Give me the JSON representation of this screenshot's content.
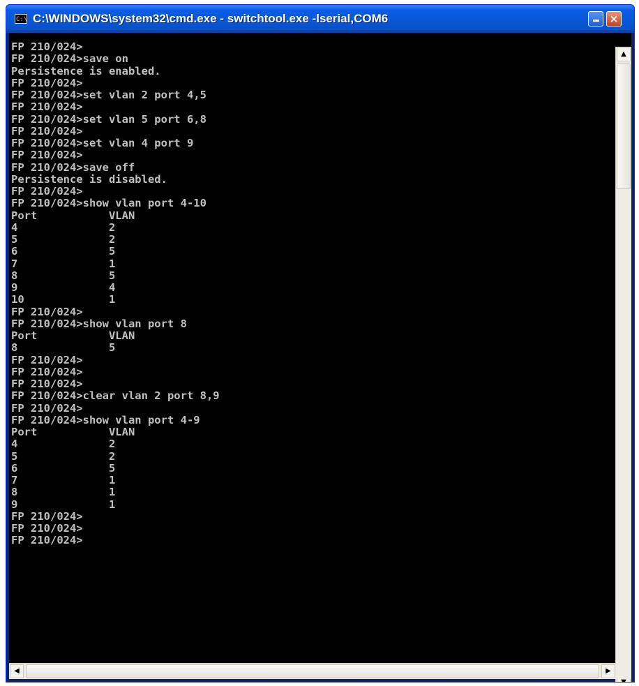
{
  "window": {
    "title": "C:\\WINDOWS\\system32\\cmd.exe - switchtool.exe -lserial,COM6",
    "icon": "cmd-icon",
    "icon_glyph": "C:\\",
    "minimize_glyph": "_",
    "close_glyph": "×"
  },
  "console": {
    "lines": [
      "FP 210/024>",
      "FP 210/024>save on",
      "Persistence is enabled.",
      "FP 210/024>",
      "FP 210/024>set vlan 2 port 4,5",
      "FP 210/024>",
      "FP 210/024>set vlan 5 port 6,8",
      "FP 210/024>",
      "FP 210/024>set vlan 4 port 9",
      "FP 210/024>",
      "FP 210/024>save off",
      "Persistence is disabled.",
      "FP 210/024>",
      "FP 210/024>show vlan port 4-10",
      "Port           VLAN",
      "4              2",
      "5              2",
      "6              5",
      "7              1",
      "8              5",
      "9              4",
      "10             1",
      "FP 210/024>",
      "FP 210/024>show vlan port 8",
      "Port           VLAN",
      "8              5",
      "FP 210/024>",
      "FP 210/024>",
      "FP 210/024>",
      "FP 210/024>clear vlan 2 port 8,9",
      "FP 210/024>",
      "FP 210/024>show vlan port 4-9",
      "Port           VLAN",
      "4              2",
      "5              2",
      "6              5",
      "7              1",
      "8              1",
      "9              1",
      "FP 210/024>",
      "FP 210/024>",
      "FP 210/024>"
    ]
  },
  "scrollbar": {
    "up": "▲",
    "down": "▼",
    "left": "◀",
    "right": "▶",
    "vertical_position": 0.0
  },
  "colors": {
    "console_bg": "#000000",
    "console_fg": "#c0c0c0",
    "titlebar": "#0a5ce6"
  }
}
